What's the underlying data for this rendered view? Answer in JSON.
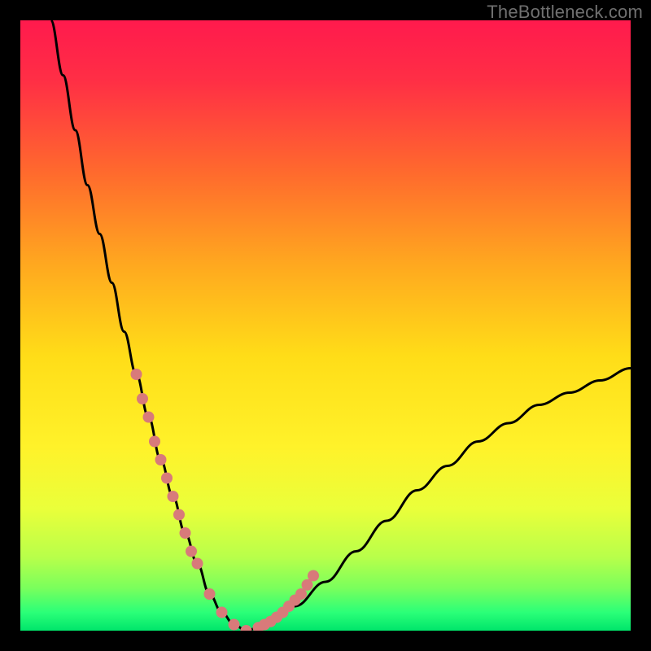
{
  "watermark": "TheBottleneck.com",
  "colors": {
    "gradient_stops": [
      {
        "offset": 0.0,
        "color": "#ff1a4d"
      },
      {
        "offset": 0.1,
        "color": "#ff2f45"
      },
      {
        "offset": 0.25,
        "color": "#ff6a2d"
      },
      {
        "offset": 0.4,
        "color": "#ffa81f"
      },
      {
        "offset": 0.55,
        "color": "#ffdd18"
      },
      {
        "offset": 0.7,
        "color": "#fff22a"
      },
      {
        "offset": 0.8,
        "color": "#eaff3a"
      },
      {
        "offset": 0.88,
        "color": "#b8ff4a"
      },
      {
        "offset": 0.93,
        "color": "#7aff5c"
      },
      {
        "offset": 0.97,
        "color": "#2bff78"
      },
      {
        "offset": 1.0,
        "color": "#00e56b"
      }
    ],
    "curve": "#000000",
    "dots": "#d87a7a",
    "frame": "#000000"
  },
  "chart_data": {
    "type": "line",
    "title": "",
    "xlabel": "",
    "ylabel": "",
    "xlim": [
      0,
      100
    ],
    "ylim": [
      0,
      100
    ],
    "series": [
      {
        "name": "bottleneck-curve",
        "x": [
          5,
          7,
          9,
          11,
          13,
          15,
          17,
          19,
          21,
          23,
          25,
          27,
          29,
          31,
          33,
          35,
          37,
          40,
          45,
          50,
          55,
          60,
          65,
          70,
          75,
          80,
          85,
          90,
          95,
          100
        ],
        "y": [
          100,
          91,
          82,
          73,
          65,
          57,
          49,
          42,
          35,
          28,
          22,
          16,
          11,
          6,
          3,
          1,
          0,
          1,
          4,
          8,
          13,
          18,
          23,
          27,
          31,
          34,
          37,
          39,
          41,
          43
        ]
      }
    ],
    "scatter_points": {
      "name": "highlight-dots",
      "x": [
        19,
        20,
        21,
        22,
        23,
        24,
        25,
        26,
        27,
        28,
        29,
        31,
        33,
        35,
        37,
        39,
        40,
        41,
        42,
        43,
        44,
        45,
        46,
        47,
        48
      ],
      "y": [
        42,
        38,
        35,
        31,
        28,
        25,
        22,
        19,
        16,
        13,
        11,
        6,
        3,
        1,
        0,
        0.5,
        1,
        1.5,
        2.2,
        3,
        4,
        5,
        6,
        7.5,
        9
      ]
    },
    "grid": false,
    "legend": false
  }
}
